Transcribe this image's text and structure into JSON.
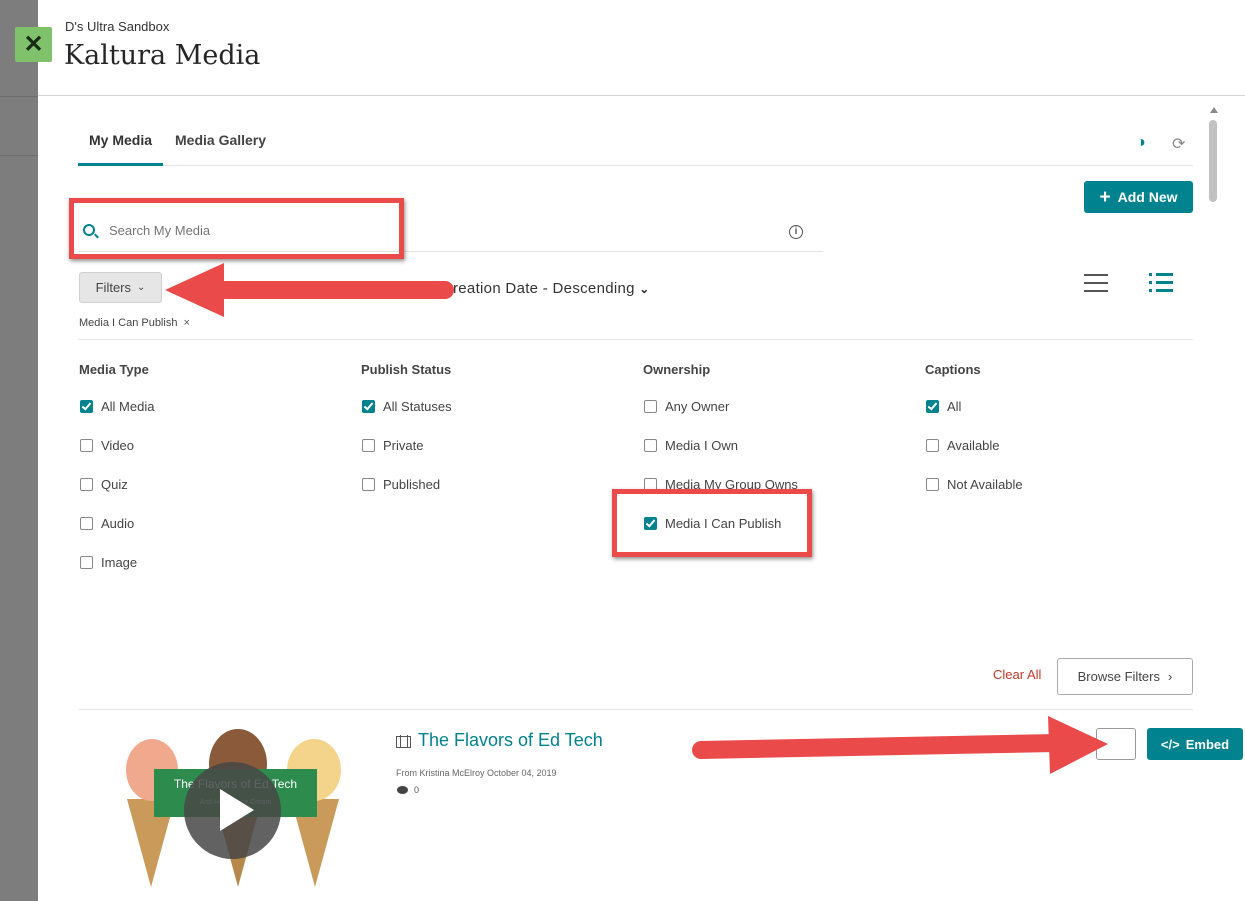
{
  "header": {
    "course_name": "D's Ultra Sandbox",
    "title": "Kaltura Media",
    "close_icon": "close-icon"
  },
  "tabs": [
    {
      "label": "My Media",
      "active": true
    },
    {
      "label": "Media Gallery",
      "active": false
    }
  ],
  "toolbar": {
    "contrast_icon": "contrast-icon",
    "refresh_icon": "refresh-icon",
    "add_new_label": "Add New"
  },
  "search": {
    "placeholder": "Search My Media",
    "value": ""
  },
  "filters": {
    "button_label": "Filters",
    "sort_label": "reation Date - Descending",
    "active_chip": "Media I Can Publish",
    "groups": [
      {
        "heading": "Media Type",
        "options": [
          {
            "label": "All Media",
            "checked": true
          },
          {
            "label": "Video",
            "checked": false
          },
          {
            "label": "Quiz",
            "checked": false
          },
          {
            "label": "Audio",
            "checked": false
          },
          {
            "label": "Image",
            "checked": false
          }
        ]
      },
      {
        "heading": "Publish Status",
        "options": [
          {
            "label": "All Statuses",
            "checked": true
          },
          {
            "label": "Private",
            "checked": false
          },
          {
            "label": "Published",
            "checked": false
          }
        ]
      },
      {
        "heading": "Ownership",
        "options": [
          {
            "label": "Any Owner",
            "checked": false
          },
          {
            "label": "Media I Own",
            "checked": false
          },
          {
            "label": "Media My Group Owns",
            "checked": false
          },
          {
            "label": "Media I Can Publish",
            "checked": true
          }
        ]
      },
      {
        "heading": "Captions",
        "options": [
          {
            "label": "All",
            "checked": true
          },
          {
            "label": "Available",
            "checked": false
          },
          {
            "label": "Not Available",
            "checked": false
          }
        ]
      }
    ],
    "clear_all_label": "Clear All",
    "browse_filters_label": "Browse Filters"
  },
  "media_item": {
    "title": "The Flavors of Ed Tech",
    "meta": "From Kristina McElroy October 04, 2019",
    "comments": "0",
    "thumb_title": "The Flavors of Ed Tech",
    "thumb_subtitle": "And How … Ice Cream",
    "embed_label": "Embed"
  },
  "colors": {
    "accent": "#00838f",
    "annotation": "#ea4a4a",
    "clear_all": "#c0392b"
  }
}
